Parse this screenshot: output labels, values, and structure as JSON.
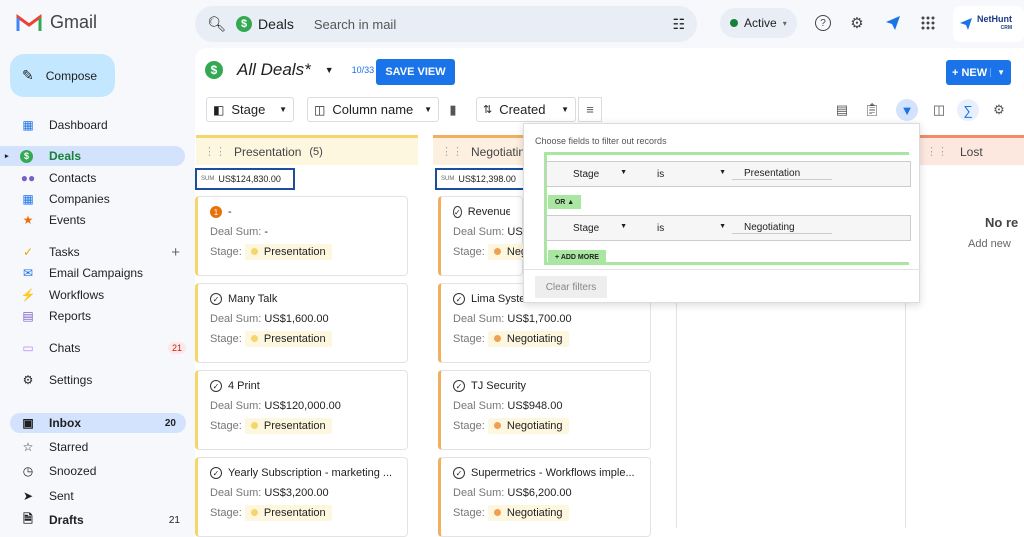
{
  "app": {
    "name": "Gmail"
  },
  "search": {
    "chip_label": "Deals",
    "placeholder": "Search in mail"
  },
  "status": {
    "label": "Active"
  },
  "brand": {
    "name": "NetHunt",
    "sub": "CRM"
  },
  "sidebar": {
    "compose_label": "Compose",
    "items": [
      {
        "label": "Dashboard",
        "icon": "dashboard-icon"
      },
      {
        "label": "Deals",
        "icon": "dollar-icon"
      },
      {
        "label": "Contacts",
        "icon": "contacts-icon"
      },
      {
        "label": "Companies",
        "icon": "companies-icon"
      },
      {
        "label": "Events",
        "icon": "star-icon"
      },
      {
        "label": "Tasks",
        "icon": "tasks-icon"
      },
      {
        "label": "Email Campaigns",
        "icon": "campaigns-icon"
      },
      {
        "label": "Workflows",
        "icon": "workflows-icon"
      },
      {
        "label": "Reports",
        "icon": "reports-icon"
      },
      {
        "label": "Chats",
        "icon": "chat-icon",
        "badge": "21"
      },
      {
        "label": "Settings",
        "icon": "gear-icon"
      },
      {
        "label": "Inbox",
        "icon": "inbox-icon",
        "count": "20"
      },
      {
        "label": "Starred",
        "icon": "star-outline-icon"
      },
      {
        "label": "Snoozed",
        "icon": "clock-icon"
      },
      {
        "label": "Sent",
        "icon": "send-icon"
      },
      {
        "label": "Drafts",
        "icon": "draft-icon",
        "count": "21"
      }
    ]
  },
  "view": {
    "title": "All Deals*",
    "count": "10/33",
    "save_label": "SAVE VIEW",
    "new_label": "+ NEW"
  },
  "toolbar": {
    "group_by": "Stage",
    "column_name": "Column name",
    "sort_by": "Created"
  },
  "columns": [
    {
      "title": "Presentation",
      "count": "(5)",
      "sum_tag": "SUM",
      "sum": "US$124,830.00"
    },
    {
      "title": "Negotiating",
      "sum_tag": "SUM",
      "sum": "US$12,398.00"
    },
    {
      "title": "Lost",
      "empty_title": "No re",
      "empty_sub": "Add new"
    }
  ],
  "cards_presentation": [
    {
      "name": "-",
      "deal_sum_label": "Deal Sum:",
      "deal_sum": "-",
      "stage_label": "Stage:",
      "stage": "Presentation",
      "badge": "1"
    },
    {
      "name": "Many Talk",
      "deal_sum_label": "Deal Sum:",
      "deal_sum": "US$1,600.00",
      "stage_label": "Stage:",
      "stage": "Presentation"
    },
    {
      "name": "4 Print",
      "deal_sum_label": "Deal Sum:",
      "deal_sum": "US$120,000.00",
      "stage_label": "Stage:",
      "stage": "Presentation"
    },
    {
      "name": "Yearly Subscription - marketing ...",
      "deal_sum_label": "Deal Sum:",
      "deal_sum": "US$3,200.00",
      "stage_label": "Stage:",
      "stage": "Presentation"
    }
  ],
  "cards_negotiating": [
    {
      "name": "Revenue Lo",
      "deal_sum_label": "Deal Sum:",
      "deal_sum": "US$",
      "stage_label": "Stage:",
      "stage": "Neg"
    },
    {
      "name": "Lima Systems",
      "deal_sum_label": "Deal Sum:",
      "deal_sum": "US$1,700.00",
      "stage_label": "Stage:",
      "stage": "Negotiating"
    },
    {
      "name": "TJ Security",
      "deal_sum_label": "Deal Sum:",
      "deal_sum": "US$948.00",
      "stage_label": "Stage:",
      "stage": "Negotiating"
    },
    {
      "name": "Supermetrics - Workflows imple...",
      "deal_sum_label": "Deal Sum:",
      "deal_sum": "US$6,200.00",
      "stage_label": "Stage:",
      "stage": "Negotiating"
    }
  ],
  "filter_popup": {
    "header": "Choose fields to filter out records",
    "rows": [
      {
        "field": "Stage",
        "op": "is",
        "value": "Presentation"
      },
      {
        "field": "Stage",
        "op": "is",
        "value": "Negotiating"
      }
    ],
    "or_label": "OR ▲",
    "add_more_label": "+ ADD MORE",
    "clear_label": "Clear filters"
  }
}
